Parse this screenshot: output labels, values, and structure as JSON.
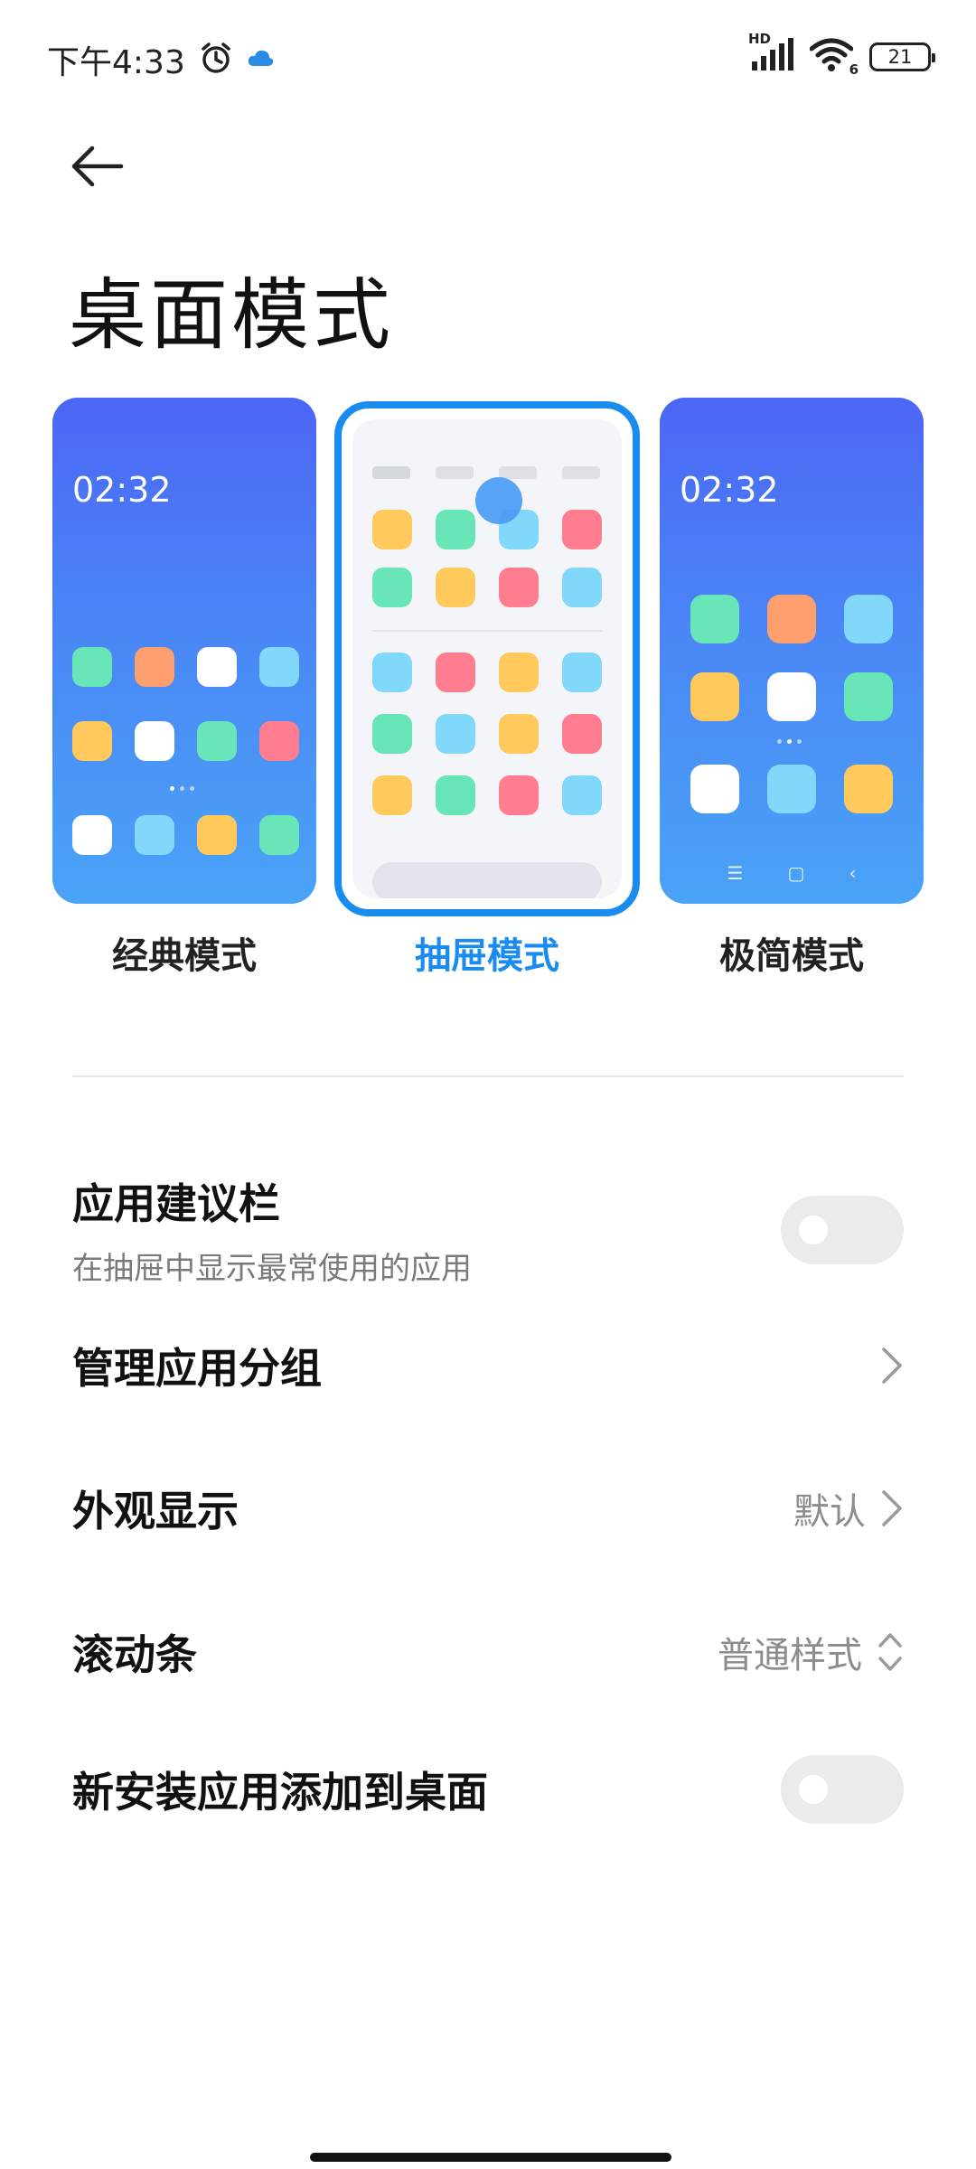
{
  "status_bar": {
    "time": "下午4:33",
    "network_label": "HD",
    "wifi_label": "6",
    "battery": "21",
    "cloud_color": "#2b8ce6"
  },
  "page": {
    "title": "桌面模式"
  },
  "modes": [
    {
      "label": "经典模式",
      "clock": "02:32",
      "active": false
    },
    {
      "label": "抽屉模式",
      "active": true
    },
    {
      "label": "极简模式",
      "clock": "02:32",
      "active": false
    }
  ],
  "settings": {
    "suggestions": {
      "title": "应用建议栏",
      "subtitle": "在抽屉中显示最常使用的应用",
      "enabled": false
    },
    "groups": {
      "title": "管理应用分组"
    },
    "appearance": {
      "title": "外观显示",
      "value": "默认"
    },
    "scrollbar": {
      "title": "滚动条",
      "value": "普通样式"
    },
    "add_new_apps": {
      "title": "新安装应用添加到桌面",
      "enabled": false
    }
  },
  "colors": {
    "accent": "#1a8cf0",
    "icon_green": "#68e6b8",
    "icon_orange": "#ff9f6e",
    "icon_yellow": "#ffc95c",
    "icon_red": "#ff7d8f",
    "icon_cyan": "#82d8fb",
    "icon_white": "#ffffff"
  }
}
